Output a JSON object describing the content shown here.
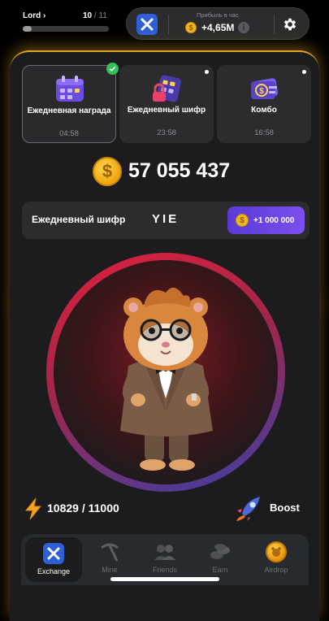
{
  "header": {
    "level_name": "Lord",
    "level_current": "10",
    "level_separator": " / ",
    "level_total": "11",
    "level_progress_fraction": 0.1,
    "profit_label": "Прибыль в час",
    "profit_value": "+4,65M",
    "logo_icon": "x-logo-icon",
    "settings_icon": "gear-icon"
  },
  "cards": [
    {
      "title": "Ежедневная награда",
      "time": "04:58",
      "icon": "calendar-icon",
      "completed": true
    },
    {
      "title": "Ежедневный шифр",
      "time": "23:58",
      "icon": "cipher-lock-icon",
      "completed": false
    },
    {
      "title": "Комбо",
      "time": "16:58",
      "icon": "combo-cards-icon",
      "completed": false
    }
  ],
  "balance": {
    "value": "57 055 437",
    "icon": "coin-icon"
  },
  "cipher": {
    "label": "Ежедневный шифр",
    "code": "YIE",
    "reward": "+1 000 000"
  },
  "energy": {
    "current": "10829",
    "separator": " / ",
    "max": "11000",
    "icon": "lightning-icon"
  },
  "boost": {
    "label": "Boost",
    "icon": "rocket-icon"
  },
  "nav": [
    {
      "label": "Exchange",
      "icon": "exchange-logo-icon",
      "active": true
    },
    {
      "label": "Mine",
      "icon": "pickaxe-icon",
      "active": false
    },
    {
      "label": "Friends",
      "icon": "friends-icon",
      "active": false
    },
    {
      "label": "Earn",
      "icon": "coins-stack-icon",
      "active": false
    },
    {
      "label": "Airdrop",
      "icon": "airdrop-coin-icon",
      "active": false
    }
  ],
  "colors": {
    "accent_gold": "#e3a51d",
    "panel_bg": "#1c1c1e",
    "card_bg": "#2c2c2e",
    "reward_purple": "#6a45e6",
    "logo_blue": "#2f5fd6",
    "check_green": "#30c15a"
  }
}
